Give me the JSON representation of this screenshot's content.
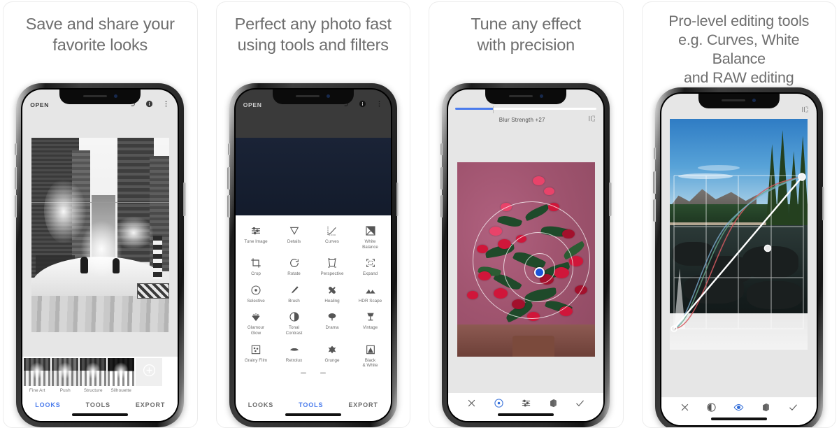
{
  "gallery": {
    "panels": [
      {
        "heading": "Save and share your\nfavorite looks",
        "app": {
          "topbar": {
            "open_label": "OPEN",
            "icons": [
              "undo-icon",
              "info-icon",
              "more-vert-icon"
            ]
          },
          "looks": [
            {
              "name": "Fine Art"
            },
            {
              "name": "Push"
            },
            {
              "name": "Structure"
            },
            {
              "name": "Silhouette"
            }
          ],
          "add_look_label": "add-look",
          "nav": [
            {
              "label": "LOOKS",
              "active": true
            },
            {
              "label": "TOOLS",
              "active": false
            },
            {
              "label": "EXPORT",
              "active": false
            }
          ]
        }
      },
      {
        "heading": "Perfect any photo fast\nusing tools and filters",
        "app": {
          "topbar": {
            "open_label": "OPEN",
            "icons": [
              "undo-icon",
              "info-icon",
              "more-vert-icon"
            ]
          },
          "tools": [
            {
              "label": "Tune Image",
              "icon": "tune-icon"
            },
            {
              "label": "Details",
              "icon": "triangle-down-icon"
            },
            {
              "label": "Curves",
              "icon": "curves-icon"
            },
            {
              "label": "White\nBalance",
              "icon": "white-balance-icon"
            },
            {
              "label": "Crop",
              "icon": "crop-icon"
            },
            {
              "label": "Rotate",
              "icon": "rotate-icon"
            },
            {
              "label": "Perspective",
              "icon": "perspective-icon"
            },
            {
              "label": "Expand",
              "icon": "expand-icon"
            },
            {
              "label": "Selective",
              "icon": "selective-icon"
            },
            {
              "label": "Brush",
              "icon": "brush-icon"
            },
            {
              "label": "Healing",
              "icon": "healing-icon"
            },
            {
              "label": "HDR Scape",
              "icon": "hdr-scape-icon"
            },
            {
              "label": "Glamour\nGlow",
              "icon": "glamour-glow-icon"
            },
            {
              "label": "Tonal\nContrast",
              "icon": "tonal-contrast-icon"
            },
            {
              "label": "Drama",
              "icon": "drama-icon"
            },
            {
              "label": "Vintage",
              "icon": "vintage-icon"
            },
            {
              "label": "Grainy Film",
              "icon": "grainy-film-icon"
            },
            {
              "label": "Retrolux",
              "icon": "retrolux-icon"
            },
            {
              "label": "Grunge",
              "icon": "grunge-icon"
            },
            {
              "label": "Black\n& White",
              "icon": "black-white-icon"
            }
          ],
          "nav": [
            {
              "label": "LOOKS",
              "active": false
            },
            {
              "label": "TOOLS",
              "active": true
            },
            {
              "label": "EXPORT",
              "active": false
            }
          ]
        }
      },
      {
        "heading": "Tune any effect\nwith precision",
        "app": {
          "slider": {
            "label": "Blur Strength +27",
            "value": 27,
            "min": 0,
            "max": 100,
            "fill_color": "#4a7bec"
          },
          "compare_icon": "compare-icon",
          "control_point": "selective-control-point",
          "toolbar": [
            {
              "icon": "close-icon",
              "active": false
            },
            {
              "icon": "selective-icon",
              "active": true
            },
            {
              "icon": "tune-icon",
              "active": false
            },
            {
              "icon": "stack-icon",
              "active": false
            },
            {
              "icon": "check-icon",
              "active": false
            }
          ]
        }
      },
      {
        "heading": "Pro-level editing tools\ne.g. Curves, White Balance\nand RAW editing",
        "app": {
          "compare_icon": "compare-icon",
          "curves": {
            "grid": true,
            "rgb_line": [
              [
                0,
                0
              ],
              [
                100,
                100
              ]
            ],
            "points": [
              [
                0,
                0
              ],
              [
                62,
                57
              ],
              [
                100,
                100
              ]
            ],
            "channels": [
              "red",
              "green",
              "blue"
            ]
          },
          "toolbar": [
            {
              "icon": "close-icon",
              "active": false
            },
            {
              "icon": "contrast-circle-icon",
              "active": false
            },
            {
              "icon": "eye-icon",
              "active": true
            },
            {
              "icon": "stack-icon",
              "active": false
            },
            {
              "icon": "check-icon",
              "active": false
            }
          ]
        }
      }
    ]
  },
  "colors": {
    "accent": "#4a7bec",
    "heading": "#6e6e6e",
    "screen_bg": "#e6e6e6"
  }
}
